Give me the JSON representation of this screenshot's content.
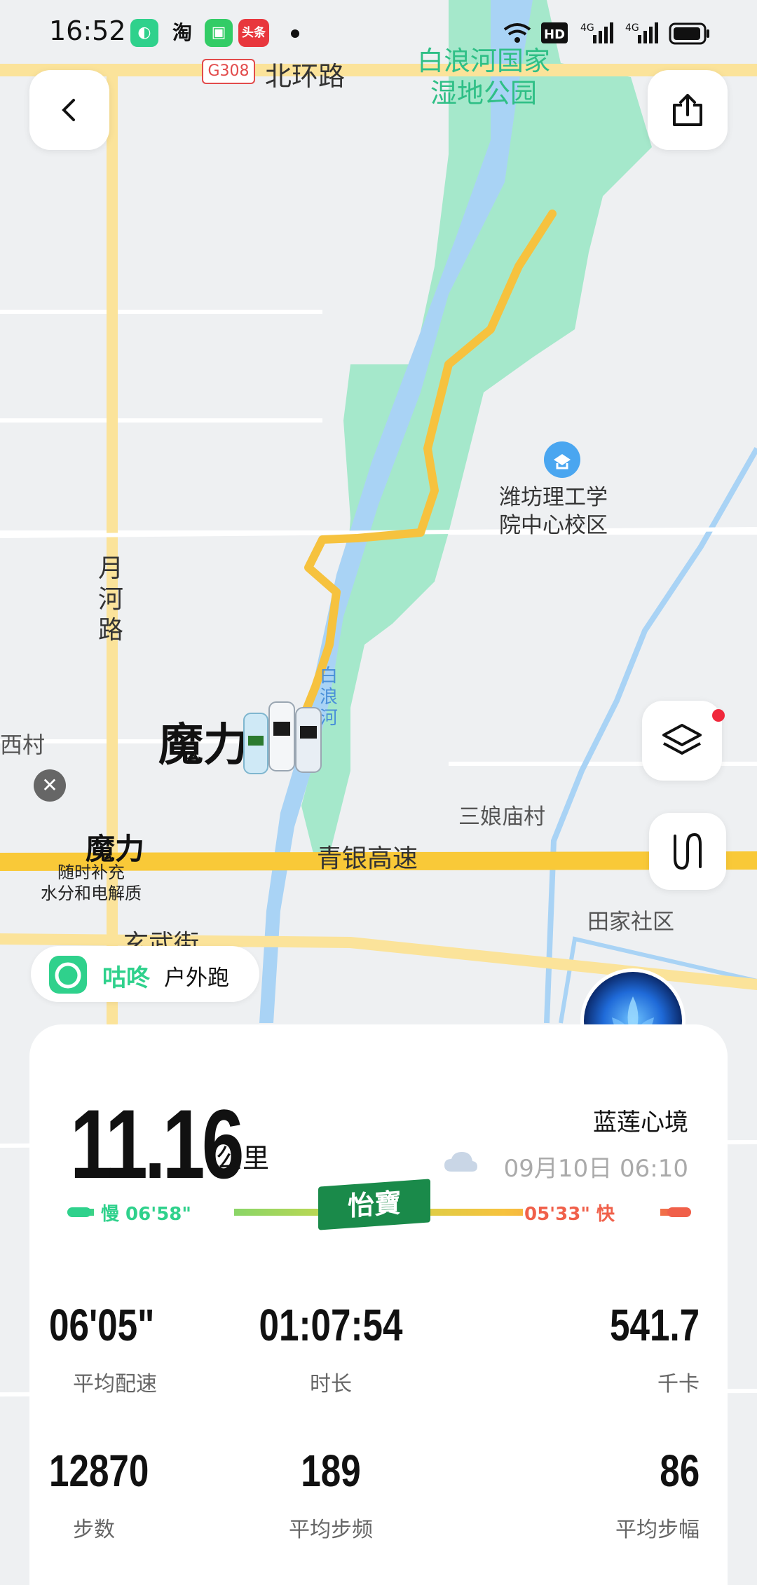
{
  "status_bar": {
    "time": "16:52",
    "app_icons": [
      {
        "name": "gudong-app-icon",
        "label": "",
        "color": "#2fd18c"
      },
      {
        "name": "taobao-app-icon",
        "label": "淘",
        "color": "#ffffff"
      },
      {
        "name": "shop-app-icon",
        "label": "",
        "color": "#33cc66"
      },
      {
        "name": "toutiao-app-icon",
        "label": "头条",
        "color": "#e8373d"
      }
    ],
    "hd_badge": "HD",
    "signal_1": "4G",
    "signal_2": "4G"
  },
  "map": {
    "road_badge": "G308",
    "labels": {
      "north_ring": "北环路",
      "wetland": "白浪河国家\n湿地公园",
      "school": "潍坊理工学\n院中心校区",
      "yuehe_road": "月\n河\n路",
      "xi_village": "西村",
      "river": "白\n浪\n河",
      "sanniang": "三娘庙村",
      "qingyin": "青银高速",
      "tianjia": "田家社区",
      "xuanwu": "玄武街"
    }
  },
  "ad": {
    "headline": "魔力",
    "small_title": "魔力",
    "tagline": "随时补充\n水分和电解质"
  },
  "brand": {
    "name": "咕咚",
    "activity": "户外跑"
  },
  "summary": {
    "distance": "11.16",
    "unit": "公里",
    "username": "蓝莲心境",
    "datetime": "09月10日 06:10",
    "pace_slow": "慢 06'58\"",
    "pace_fast": "05'33\" 快",
    "sponsor": "怡寶"
  },
  "stats": [
    {
      "value": "06'05\"",
      "label": "平均配速"
    },
    {
      "value": "01:07:54",
      "label": "时长"
    },
    {
      "value": "541.7",
      "label": "千卡"
    },
    {
      "value": "12870",
      "label": "步数"
    },
    {
      "value": "189",
      "label": "平均步频"
    },
    {
      "value": "86",
      "label": "平均步幅"
    }
  ],
  "colors": {
    "brand_green": "#2fd18c",
    "route_yellow": "#f6c23e",
    "water": "#a9d3f5",
    "park": "#a5e8cb",
    "road": "#fbe39a"
  }
}
